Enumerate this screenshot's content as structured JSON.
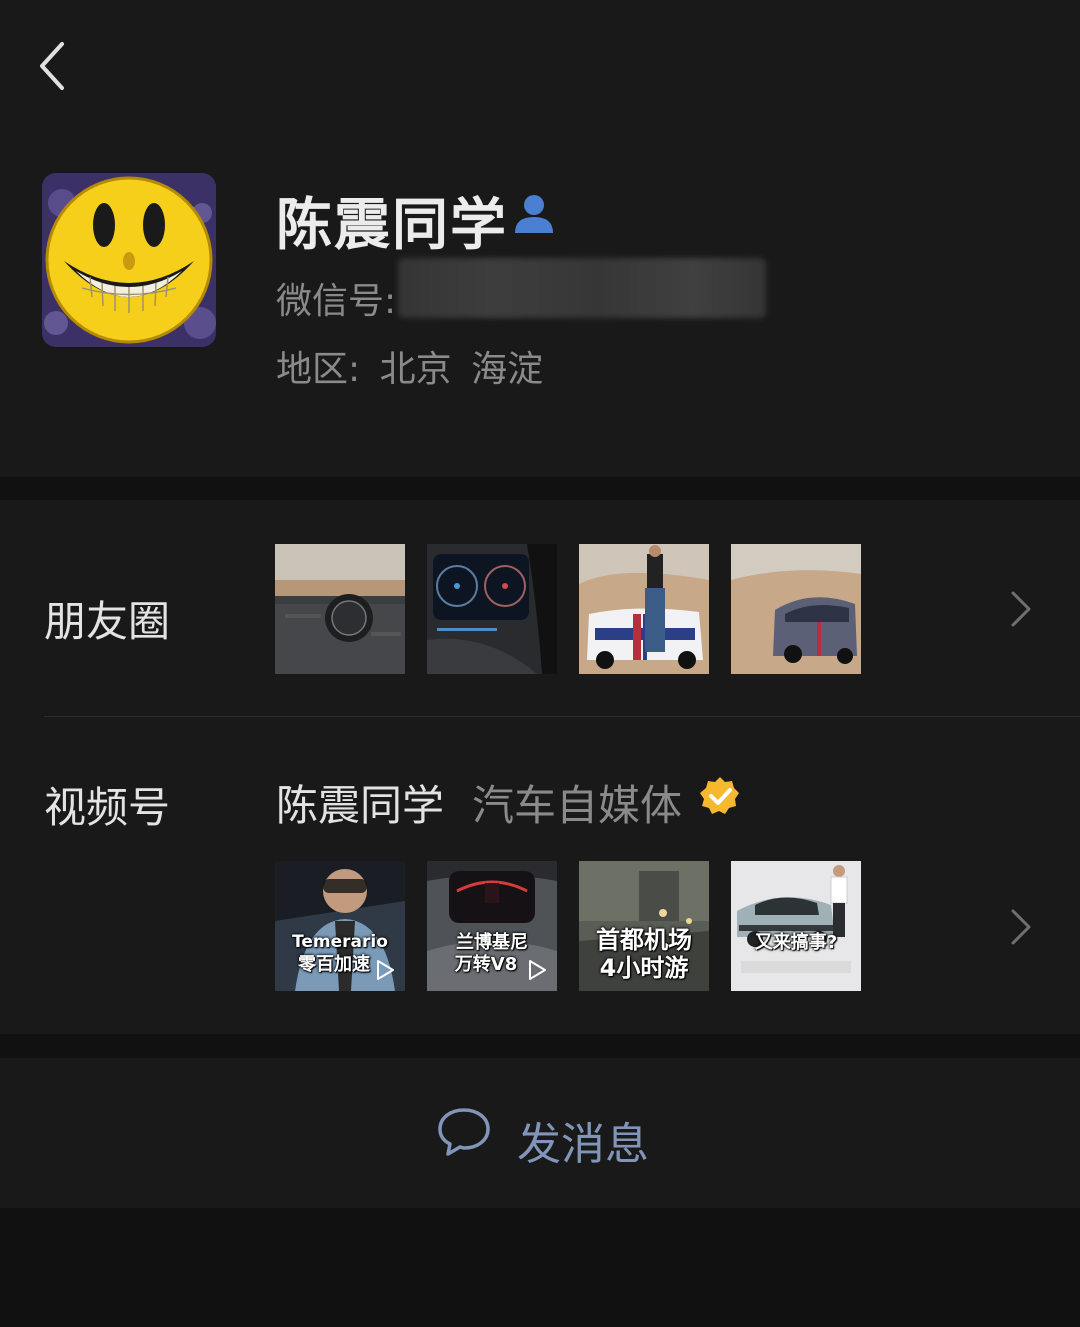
{
  "profile": {
    "name": "陈震同学",
    "wechat_id_label": "微信号:",
    "region_label": "地区:",
    "region_city": "北京",
    "region_district": "海淀"
  },
  "moments": {
    "label": "朋友圈",
    "photos": [
      "porsche-dashboard-desert",
      "porsche-gauge-cluster",
      "man-with-911-dakar",
      "911-dakar-in-desert"
    ]
  },
  "channels": {
    "label": "视频号",
    "account_name": "陈震同学",
    "category": "汽车自媒体",
    "videos": [
      {
        "line1": "Temerario",
        "line2": "零百加速"
      },
      {
        "line1": "兰博基尼",
        "line2": "万转V8"
      },
      {
        "line1": "首都机场",
        "line2": "4小时游"
      },
      {
        "line1": "又来搞事?",
        "line2": ""
      }
    ]
  },
  "actions": {
    "send_message_label": "发消息"
  },
  "colors": {
    "background": "#111111",
    "panel": "#191919",
    "accent_blue": "#4a7fd1",
    "verified_gold": "#f5b82e",
    "link_blue": "#8095b8"
  },
  "icons": [
    "back-chevron-icon",
    "person-icon",
    "verified-badge-icon",
    "chevron-right-icon",
    "play-icon",
    "chat-bubble-icon"
  ]
}
